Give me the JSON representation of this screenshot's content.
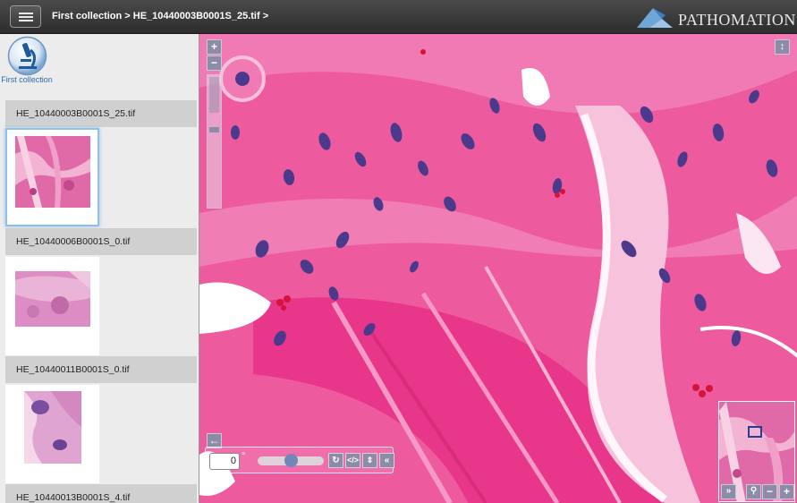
{
  "header": {
    "breadcrumb": "First collection > HE_10440003B0001S_25.tif >",
    "logo_text": "PATHOMATION"
  },
  "sidebar": {
    "collection_label": "First collection",
    "slides": [
      {
        "name": "HE_10440003B0001S_25.tif",
        "selected": true
      },
      {
        "name": "HE_10440006B0001S_0.tif",
        "selected": false
      },
      {
        "name": "HE_10440011B0001S_0.tif",
        "selected": false
      },
      {
        "name": "HE_10440013B0001S_4.tif",
        "selected": false
      }
    ]
  },
  "viewer": {
    "zoom_in_label": "+",
    "zoom_out_label": "−",
    "fullscreen_label": "↕",
    "back_label": "←",
    "rotation_value": "0",
    "rotation_unit": "°",
    "collapse_label": "«",
    "minimap": {
      "expand_label": "»",
      "zoom_out_label": "−",
      "zoom_in_label": "+"
    }
  },
  "colors": {
    "accent": "#8c8ca8",
    "tissue": "#ed4f98",
    "nuclei": "#4b3a8c",
    "link": "#2a6ca8"
  }
}
